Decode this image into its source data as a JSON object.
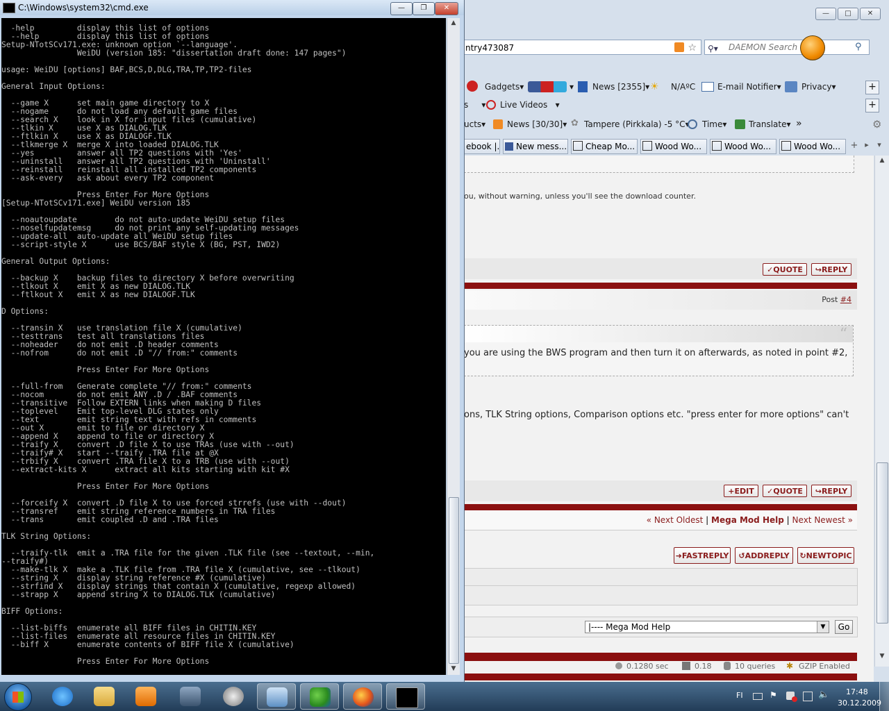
{
  "cmd": {
    "title": "C:\\Windows\\system32\\cmd.exe",
    "lines": [
      "  -help         display this list of options",
      "  --help        display this list of options",
      "Setup-NTotSCv171.exe: unknown option `--language'.",
      "                WeiDU (version 185: \"dissertation draft done: 147 pages\")",
      "",
      "usage: WeiDU [options] BAF,BCS,D,DLG,TRA,TP,TP2-files",
      "",
      "General Input Options:",
      "",
      "  --game X      set main game directory to X",
      "  --nogame      do not load any default game files",
      "  --search X    look in X for input files (cumulative)",
      "  --tlkin X     use X as DIALOG.TLK",
      "  --ftlkin X    use X as DIALOGF.TLK",
      "  --tlkmerge X  merge X into loaded DIALOG.TLK",
      "  --yes         answer all TP2 questions with 'Yes'",
      "  --uninstall   answer all TP2 questions with 'Uninstall'",
      "  --reinstall   reinstall all installed TP2 components",
      "  --ask-every   ask about every TP2 component",
      "",
      "                Press Enter For More Options",
      "[Setup-NTotSCv171.exe] WeiDU version 185",
      "",
      "  --noautoupdate        do not auto-update WeiDU setup files",
      "  --noselfupdatemsg     do not print any self-updating messages",
      "  --update-all  auto-update all WeiDU setup files",
      "  --script-style X      use BCS/BAF style X (BG, PST, IWD2)",
      "",
      "General Output Options:",
      "",
      "  --backup X    backup files to directory X before overwriting",
      "  --tlkout X    emit X as new DIALOG.TLK",
      "  --ftlkout X   emit X as new DIALOGF.TLK",
      "",
      "D Options:",
      "",
      "  --transin X   use translation file X (cumulative)",
      "  --testtrans   test all translations files",
      "  --noheader    do not emit .D header comments",
      "  --nofrom      do not emit .D \"// from:\" comments",
      "",
      "                Press Enter For More Options",
      "",
      "  --full-from   Generate complete \"// from:\" comments",
      "  --nocom       do not emit ANY .D / .BAF comments",
      "  --transitive  Follow EXTERN links when making D files",
      "  --toplevel    Emit top-level DLG states only",
      "  --text        emit string text with refs in comments",
      "  --out X       emit to file or directory X",
      "  --append X    append to file or directory X",
      "  --traify X    convert .D file X to use TRAs (use with --out)",
      "  --traify# X   start --traify .TRA file at @X",
      "  --trbify X    convert .TRA file X to a TRB (use with --out)",
      "  --extract-kits X      extract all kits starting with kit #X",
      "",
      "                Press Enter For More Options",
      "",
      "  --forceify X  convert .D file X to use forced strrefs (use with --dout)",
      "  --transref    emit string reference numbers in TRA files",
      "  --trans       emit coupled .D and .TRA files",
      "",
      "TLK String Options:",
      "",
      "  --traify-tlk  emit a .TRA file for the given .TLK file (see --textout, --min,",
      "--traify#)",
      "  --make-tlk X  make a .TLK file from .TRA file X (cumulative, see --tlkout)",
      "  --string X    display string reference #X (cumulative)",
      "  --strfind X   display strings that contain X (cumulative, regexp allowed)",
      "  --strapp X    append string X to DIALOG.TLK (cumulative)",
      "",
      "BIFF Options:",
      "",
      "  --list-biffs  enumerate all BIFF files in CHITIN.KEY",
      "  --list-files  enumerate all resource files in CHITIN.KEY",
      "  --biff X      enumerate contents of BIFF file X (cumulative)",
      "",
      "                Press Enter For More Options"
    ]
  },
  "browser": {
    "address": "ntry473087",
    "search_placeholder": "DAEMON Search",
    "toolbar1": {
      "gadgets": "Gadgets",
      "news": "News [2355]",
      "weather": "N/AºC",
      "email": "E-mail Notifier",
      "privacy": "Privacy"
    },
    "toolbar2": {
      "s": "s",
      "live_videos": "Live Videos"
    },
    "toolbar3": {
      "ucts": "ucts",
      "news": "News [30/30]",
      "weather": "Tampere (Pirkkala) -5 °C",
      "time": "Time",
      "translate": "Translate",
      "more": "»"
    },
    "tabs": [
      "ebook |...",
      "New mess...",
      "Cheap Mo...",
      "Wood Wo...",
      "Wood Wo...",
      "Wood Wo..."
    ],
    "page": {
      "warning_text": "ou, without warning, unless you'll see the download counter.",
      "quote": "QUOTE",
      "reply": "REPLY",
      "edit": "EDIT",
      "post_label": "Post",
      "post_num": "#4",
      "bws_text": " you are using the BWS program and then turn it on afterwards, as noted in point #2,",
      "options_text": "ons, TLK String options, Comparison options etc. \"press enter for more options\" can't",
      "nav_prev": "« Next Oldest",
      "nav_sep1": "|",
      "nav_title": "Mega Mod Help",
      "nav_sep2": "|",
      "nav_next": "Next Newest »",
      "fastreply": "FASTREPLY",
      "addreply": "ADDREPLY",
      "newtopic": "NEWTOPIC",
      "forum_select": "|---- Mega Mod Help",
      "go": "Go",
      "footer_time": "0.1280 sec",
      "footer_load": "0.18",
      "footer_queries": "10 queries",
      "footer_gzip": "GZIP Enabled"
    }
  },
  "taskbar": {
    "lang": "FI",
    "time": "17:48",
    "date": "30.12.2009"
  }
}
